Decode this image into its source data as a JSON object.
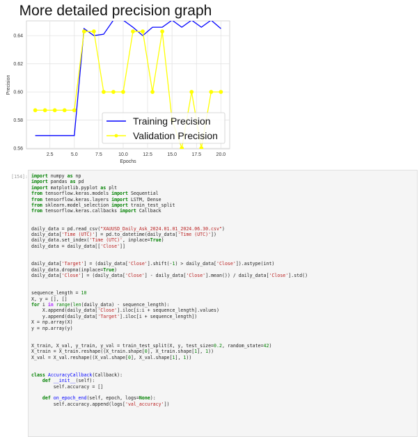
{
  "chart_data": {
    "type": "line",
    "title": "More detailed precision graph",
    "xlabel": "Epochs",
    "ylabel": "Precision",
    "xlim": [
      0.1,
      20.9
    ],
    "ylim": [
      0.5595,
      0.6505
    ],
    "xticks": [
      "2.5",
      "5.0",
      "7.5",
      "10.0",
      "12.5",
      "15.0",
      "17.5",
      "20.0"
    ],
    "yticks": [
      "0.56",
      "0.58",
      "0.60",
      "0.62",
      "0.64"
    ],
    "grid": true,
    "legend_position": "bottom-right",
    "series": [
      {
        "name": "Training Precision",
        "color": "#0000ff",
        "marker": false,
        "x": [
          1,
          2,
          3,
          4,
          5,
          6,
          7,
          8,
          9,
          10,
          11,
          12,
          13,
          14,
          15,
          16,
          17,
          18,
          19,
          20
        ],
        "y": [
          0.569,
          0.569,
          0.569,
          0.569,
          0.569,
          0.645,
          0.64,
          0.641,
          0.651,
          0.651,
          0.646,
          0.64,
          0.646,
          0.646,
          0.651,
          0.646,
          0.651,
          0.646,
          0.651,
          0.645
        ]
      },
      {
        "name": "Validation Precision",
        "color": "#ffff00",
        "marker": true,
        "x": [
          1,
          2,
          3,
          4,
          5,
          6,
          7,
          8,
          9,
          10,
          11,
          12,
          13,
          14,
          15,
          16,
          17,
          18,
          19,
          20
        ],
        "y": [
          0.587,
          0.587,
          0.587,
          0.587,
          0.587,
          0.643,
          0.643,
          0.6,
          0.6,
          0.6,
          0.643,
          0.643,
          0.6,
          0.643,
          0.58,
          0.56,
          0.6,
          0.56,
          0.6,
          0.6
        ]
      }
    ]
  },
  "notebook": {
    "prompt": "[154]:",
    "code_lines": [
      "import numpy as np",
      "import pandas as pd",
      "import matplotlib.pyplot as plt",
      "from tensorflow.keras.models import Sequential",
      "from tensorflow.keras.layers import LSTM, Dense",
      "from sklearn.model_selection import train_test_split",
      "from tensorflow.keras.callbacks import Callback",
      "",
      "",
      "daily_data = pd.read_csv(\"XAUUSD_Daily_Ask_2024.01.01_2024.06.30.csv\")",
      "daily_data['Time (UTC)'] = pd.to_datetime(daily_data['Time (UTC)'])",
      "daily_data.set_index('Time (UTC)', inplace=True)",
      "daily_data = daily_data[['Close']]",
      "",
      "",
      "daily_data['Target'] = (daily_data['Close'].shift(-1) > daily_data['Close']).astype(int)",
      "daily_data.dropna(inplace=True)",
      "daily_data['Close'] = (daily_data['Close'] - daily_data['Close'].mean()) / daily_data['Close'].std()",
      "",
      "",
      "sequence_length = 10",
      "X, y = [], []",
      "for i in range(len(daily_data) - sequence_length):",
      "    X.append(daily_data['Close'].iloc[i:i + sequence_length].values)",
      "    y.append(daily_data['Target'].iloc[i + sequence_length])",
      "X = np.array(X)",
      "y = np.array(y)",
      "",
      "",
      "X_train, X_val, y_train, y_val = train_test_split(X, y, test_size=0.2, random_state=42)",
      "X_train = X_train.reshape((X_train.shape[0], X_train.shape[1], 1))",
      "X_val = X_val.reshape((X_val.shape[0], X_val.shape[1], 1))",
      "",
      "",
      "class AccuracyCallback(Callback):",
      "    def __init__(self):",
      "        self.accuracy = []",
      "",
      "    def on_epoch_end(self, epoch, logs=None):",
      "        self.accuracy.append(logs['val_accuracy'])"
    ]
  }
}
